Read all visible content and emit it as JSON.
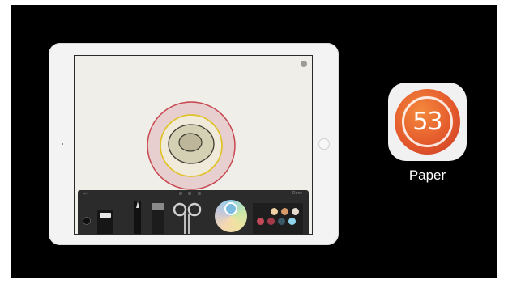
{
  "app": {
    "name": "Paper",
    "logo_text": "53"
  },
  "tray": {
    "undo_label": "↩",
    "done_label": "Done"
  },
  "drawing": {
    "rings": [
      {
        "stroke": "#c8474f",
        "fill": "#e8cfcf"
      },
      {
        "stroke": "#e0c22a",
        "fill": "#efeada"
      },
      {
        "stroke": "#3c3c30",
        "fill": "#d4d0b4"
      },
      {
        "stroke": "#3c3c30",
        "fill": "#bdb69a"
      }
    ]
  },
  "palette": {
    "swatches": [
      "#f1d2a4",
      "#d69a6a",
      "#e7dcd0",
      "#c24a58",
      "#a33a4a",
      "#3b5866",
      "#8fd3ea"
    ]
  },
  "colors": {
    "slide_background": "#000000",
    "app_accent": "#e45a2c"
  }
}
